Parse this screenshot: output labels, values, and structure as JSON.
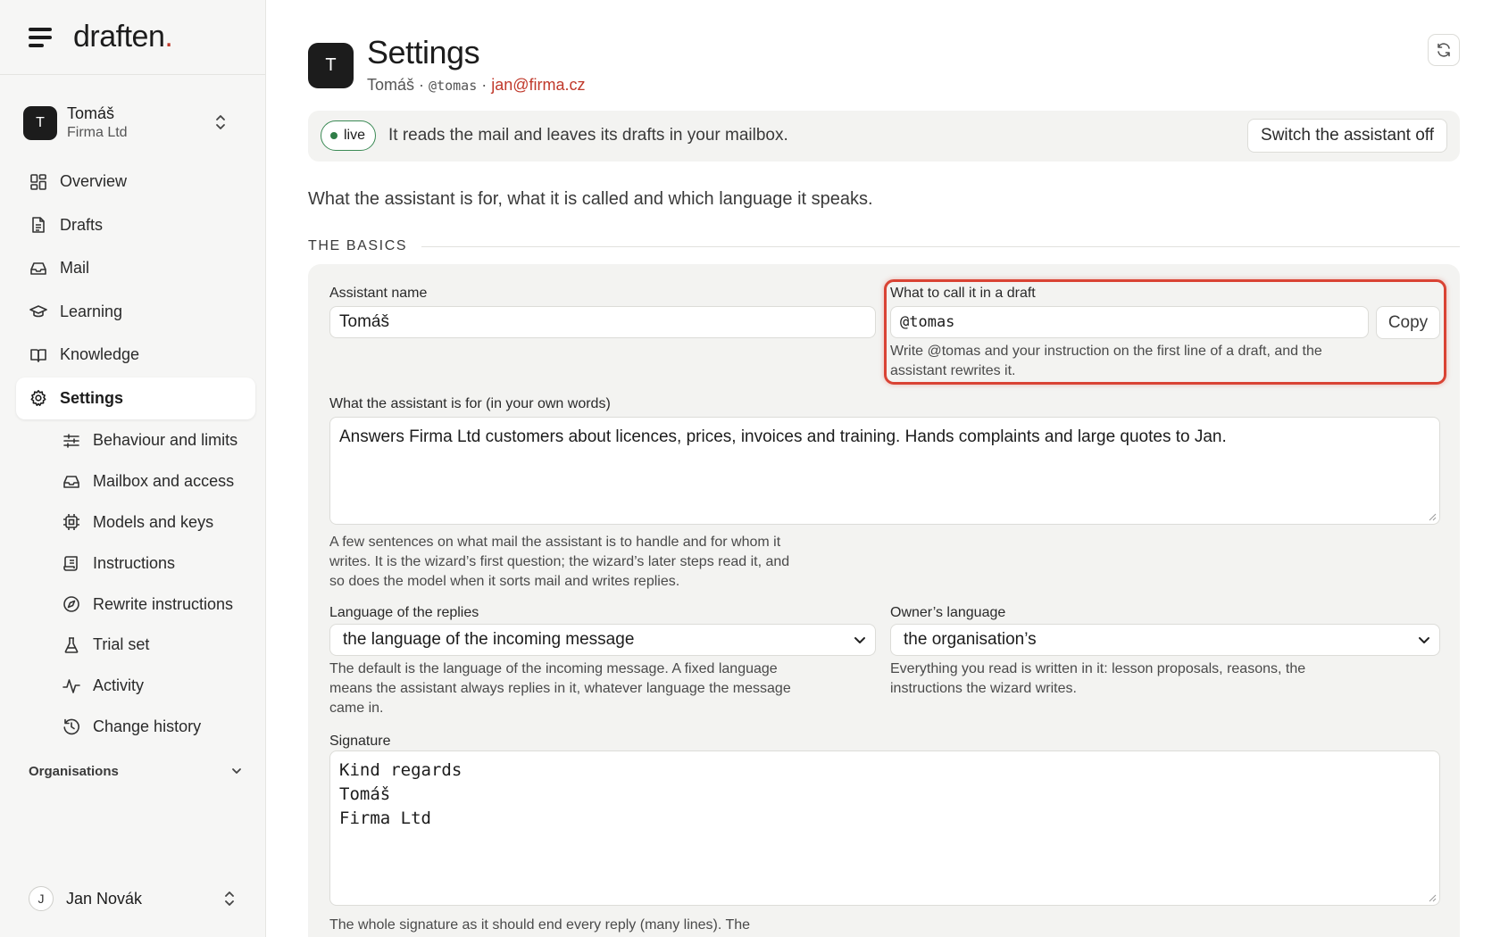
{
  "brand": {
    "name": "draften",
    "dot": "."
  },
  "assistant": {
    "initial": "T",
    "name": "Tomáš",
    "org": "Firma Ltd"
  },
  "nav": [
    {
      "label": "Overview",
      "icon": "grid-icon"
    },
    {
      "label": "Drafts",
      "icon": "document-icon"
    },
    {
      "label": "Mail",
      "icon": "inbox-icon"
    },
    {
      "label": "Learning",
      "icon": "graduation-cap-icon"
    },
    {
      "label": "Knowledge",
      "icon": "book-icon"
    },
    {
      "label": "Settings",
      "icon": "gear-icon",
      "active": true
    }
  ],
  "subnav": [
    {
      "label": "Behaviour and limits",
      "icon": "sliders-icon"
    },
    {
      "label": "Mailbox and access",
      "icon": "inbox-icon"
    },
    {
      "label": "Models and keys",
      "icon": "chip-icon"
    },
    {
      "label": "Instructions",
      "icon": "scroll-icon"
    },
    {
      "label": "Rewrite instructions",
      "icon": "compass-icon"
    },
    {
      "label": "Trial set",
      "icon": "flask-icon"
    },
    {
      "label": "Activity",
      "icon": "pulse-icon"
    },
    {
      "label": "Change history",
      "icon": "history-icon"
    }
  ],
  "organisations_label": "Organisations",
  "user": {
    "initial": "J",
    "name": "Jan Novák"
  },
  "header": {
    "initial": "T",
    "title": "Settings",
    "name": "Tomáš",
    "sep": "·",
    "handle": "@tomas",
    "email": "jan@firma.cz"
  },
  "status": {
    "badge": "live",
    "text": "It reads the mail and leaves its drafts in your mailbox.",
    "button": "Switch the assistant off"
  },
  "intro": "What the assistant is for, what it is called and which language it speaks.",
  "section_title": "THE BASICS",
  "form": {
    "name_label": "Assistant name",
    "name_value": "Tomáš",
    "call_label": "What to call it in a draft",
    "call_value": "@tomas",
    "copy_label": "Copy",
    "call_help": "Write @tomas and your instruction on the first line of a draft, and the assistant rewrites it.",
    "purpose_label": "What the assistant is for (in your own words)",
    "purpose_value": "Answers Firma Ltd customers about licences, prices, invoices and training. Hands complaints and large quotes to Jan.",
    "purpose_help": "A few sentences on what mail the assistant is to handle and for whom it writes. It is the wizard’s first question; the wizard’s later steps read it, and so does the model when it sorts mail and writes replies.",
    "reply_lang_label": "Language of the replies",
    "reply_lang_value": "the language of the incoming message",
    "reply_lang_help": "The default is the language of the incoming message. A fixed language means the assistant always replies in it, whatever language the message came in.",
    "owner_lang_label": "Owner’s language",
    "owner_lang_value": "the organisation’s",
    "owner_lang_help": "Everything you read is written in it: lesson proposals, reasons, the instructions the wizard writes.",
    "signature_label": "Signature",
    "signature_lines": [
      "Kind regards",
      "Tomáš",
      "Firma Ltd"
    ],
    "signature_help": "The whole signature as it should end every reply (many lines). The"
  },
  "colors": {
    "accent_red": "#c0392b",
    "live_green": "#2f7d47",
    "highlight": "#d94334"
  }
}
